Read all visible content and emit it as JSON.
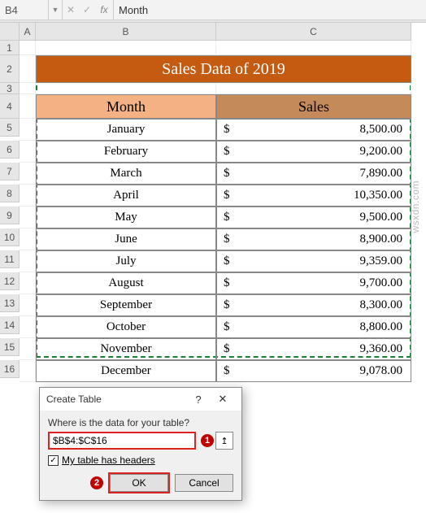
{
  "formula_bar": {
    "name_box": "B4",
    "dropdown_glyph": "▼",
    "cancel_glyph": "✕",
    "accept_glyph": "✓",
    "fx_label": "fx",
    "content": "Month"
  },
  "columns": [
    "",
    "A",
    "B",
    "C"
  ],
  "rows": [
    "1",
    "2",
    "3",
    "4",
    "5",
    "6",
    "7",
    "8",
    "9",
    "10",
    "11",
    "12",
    "13",
    "14",
    "15",
    "16"
  ],
  "title": "Sales Data of 2019",
  "headers": {
    "month": "Month",
    "sales": "Sales"
  },
  "currency_symbol": "$",
  "data": [
    {
      "month": "January",
      "sales": "8,500.00"
    },
    {
      "month": "February",
      "sales": "9,200.00"
    },
    {
      "month": "March",
      "sales": "7,890.00"
    },
    {
      "month": "April",
      "sales": "10,350.00"
    },
    {
      "month": "May",
      "sales": "9,500.00"
    },
    {
      "month": "June",
      "sales": "8,900.00"
    },
    {
      "month": "July",
      "sales": "9,359.00"
    },
    {
      "month": "August",
      "sales": "9,700.00"
    },
    {
      "month": "September",
      "sales": "8,300.00"
    },
    {
      "month": "October",
      "sales": "8,800.00"
    },
    {
      "month": "November",
      "sales": "9,360.00"
    },
    {
      "month": "December",
      "sales": "9,078.00"
    }
  ],
  "dialog": {
    "title": "Create Table",
    "help_glyph": "?",
    "close_glyph": "✕",
    "prompt": "Where is the data for your table?",
    "range_value": "$B$4:$C$16",
    "refedit_glyph": "↥",
    "checkbox_checked_glyph": "✓",
    "checkbox_label": "My table has headers",
    "ok_label": "OK",
    "cancel_label": "Cancel",
    "callout1": "1",
    "callout2": "2"
  },
  "watermark": "wsxdn.com"
}
